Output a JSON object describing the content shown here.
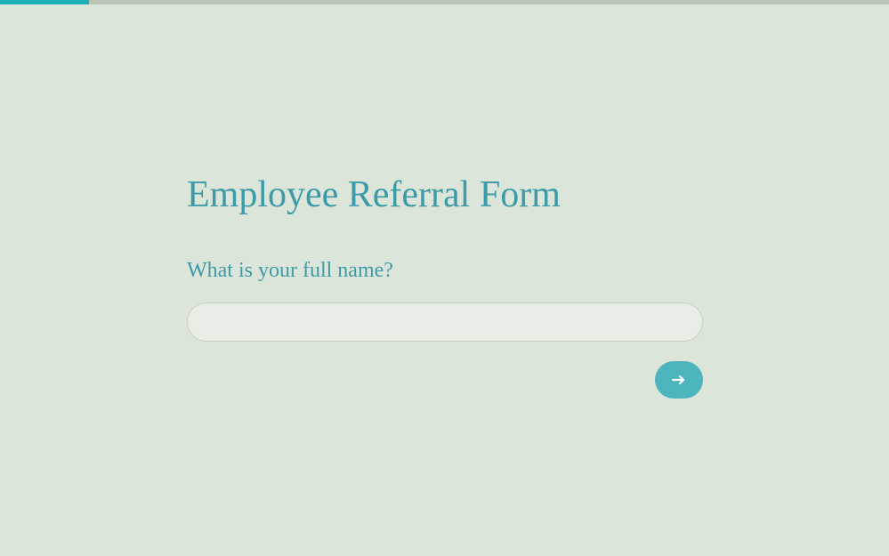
{
  "progress": {
    "percent": 10
  },
  "form": {
    "title": "Employee Referral Form",
    "question": "What is your full name?",
    "input_value": "",
    "input_placeholder": ""
  },
  "colors": {
    "background": "#dce5d9",
    "accent": "#3d9ba8",
    "button": "#4db5bd",
    "progress_fill": "#1cb0b8",
    "progress_track": "#b8c4b6"
  },
  "icons": {
    "next": "arrow-right-icon"
  }
}
